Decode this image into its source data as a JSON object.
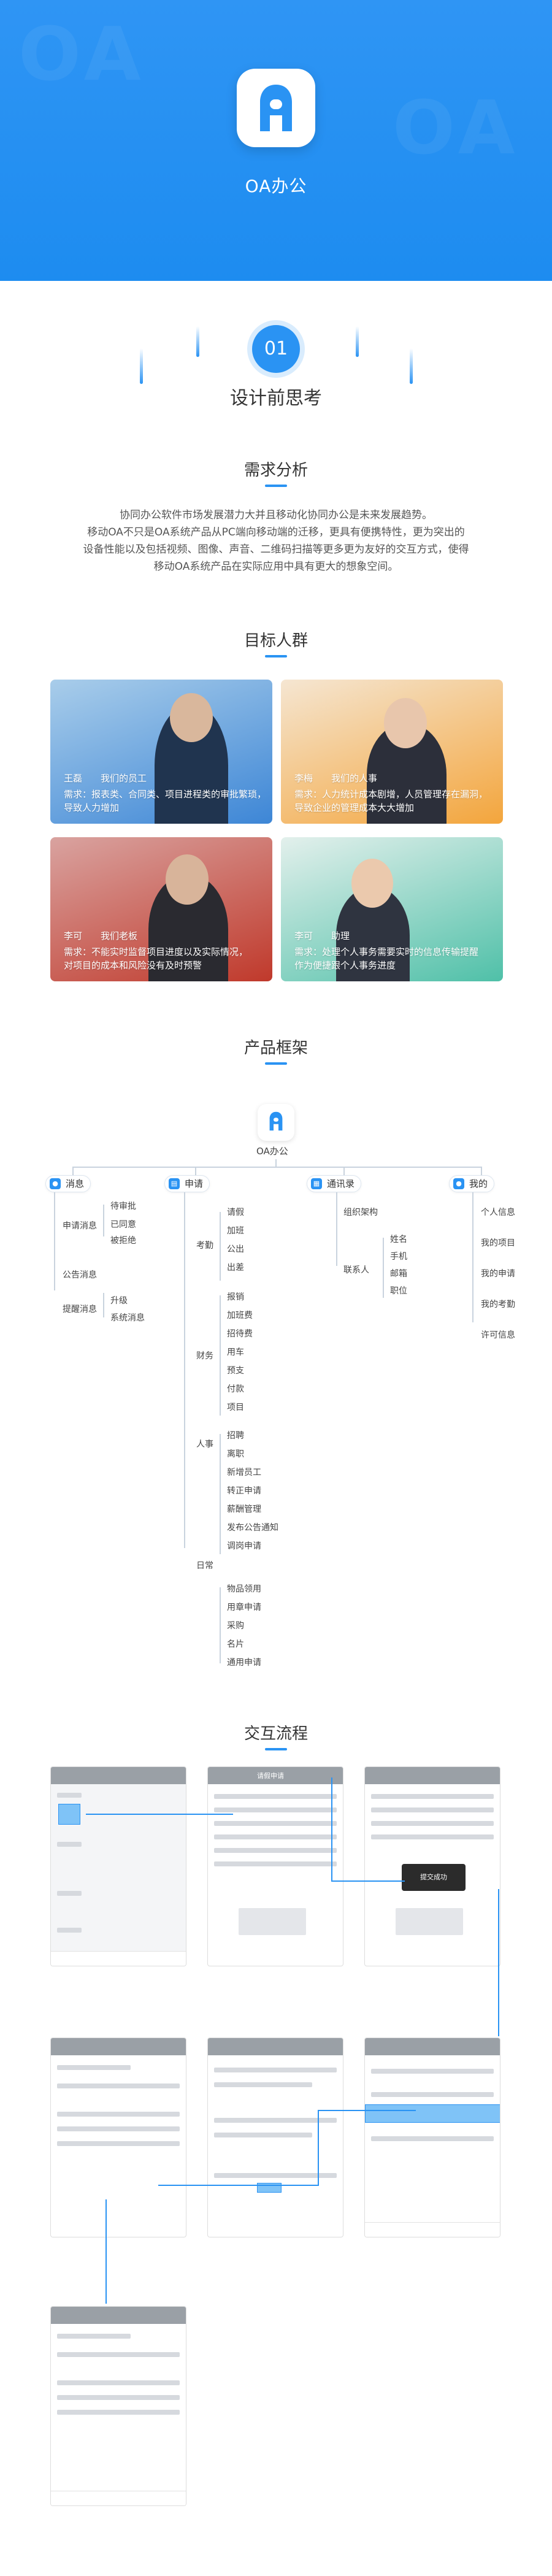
{
  "hero": {
    "app_name": "OA办公",
    "ghost_text": "OA"
  },
  "section1": {
    "number": "01",
    "title": "设计前思考"
  },
  "needs": {
    "heading": "需求分析",
    "lines": [
      "协同办公软件市场发展潜力大并且移动化协同办公是未来发展趋势。",
      "移动OA不只是OA系统产品从PC端向移动端的迁移，更具有便携特性，更为突出的",
      "设备性能以及包括视频、图像、声音、二维码扫描等更多更为友好的交互方式，使得",
      "移动OA系统产品在实际应用中具有更大的想象空间。"
    ]
  },
  "audience": {
    "heading": "目标人群",
    "cards": [
      {
        "role": "王磊　　我们的员工",
        "desc1": "需求：报表类、合同类、项目进程类的审批繁琐，",
        "desc2": "导致人力增加"
      },
      {
        "role": "李梅　　我们的人事",
        "desc1": "需求：人力统计成本剧增，人员管理存在漏洞，",
        "desc2": "导致企业的管理成本大大增加"
      },
      {
        "role": "李可　　我们老板",
        "desc1": "需求：不能实时监督项目进度以及实际情况，",
        "desc2": "对项目的成本和风险没有及时预警"
      },
      {
        "role": "李可　　助理",
        "desc1": "需求：处理个人事务需要实时的信息传输提醒",
        "desc2": "作为便捷跟个人事务进度"
      }
    ]
  },
  "framework": {
    "heading": "产品框架",
    "root": "OA办公",
    "branches": [
      {
        "label": "消息",
        "icon": "chat-icon"
      },
      {
        "label": "申请",
        "icon": "document-icon"
      },
      {
        "label": "通讯录",
        "icon": "contacts-icon"
      },
      {
        "label": "我的",
        "icon": "person-icon"
      }
    ],
    "messages": {
      "groups": [
        "申请消息",
        "公告消息",
        "提醒消息"
      ],
      "apply_items": [
        "待审批",
        "已同意",
        "被拒绝"
      ],
      "remind_items": [
        "升级",
        "系统消息"
      ]
    },
    "apply": {
      "categories": [
        "考勤",
        "财务",
        "人事",
        "日常"
      ],
      "attendance": [
        "请假",
        "加班",
        "公出",
        "出差"
      ],
      "finance": [
        "报销",
        "加班费",
        "招待费",
        "用车",
        "预支",
        "付款",
        "项目"
      ],
      "hr": [
        "招聘",
        "离职",
        "新增员工",
        "转正申请",
        "薪酬管理",
        "发布公告通知",
        "调岗申请"
      ],
      "daily": [
        "物品领用",
        "用章申请",
        "采购",
        "名片",
        "通用申请"
      ]
    },
    "contacts": {
      "org": "组织架构",
      "contact": "联系人",
      "fields": [
        "姓名",
        "手机",
        "邮箱",
        "职位"
      ]
    },
    "mine": [
      "个人信息",
      "我的项目",
      "我的申请",
      "我的考勤",
      "许可信息"
    ]
  },
  "flow": {
    "heading": "交互流程",
    "toast": "提交成功",
    "apply_title": "请假申请"
  },
  "colors": {
    "primary": "#2a93f3",
    "hero": "#1d8cf0"
  }
}
